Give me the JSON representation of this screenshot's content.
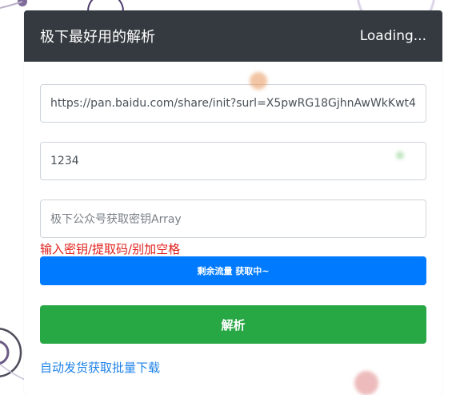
{
  "header": {
    "title": "极下最好用的解析",
    "status": "Loading..."
  },
  "form": {
    "url_value": "https://pan.baidu.com/share/init?surl=X5pwRG18GjhnAwWkKwt4",
    "code_value": "1234",
    "key_placeholder": "极下公众号获取密钥Array",
    "hint": "输入密钥/提取码/别加空格",
    "traffic_button": "剩余流量 获取中~",
    "parse_button": "解析",
    "link_text": "自动发货获取批量下载"
  },
  "colors": {
    "header_bg": "#343a40",
    "blue_button": "#007bff",
    "green_button": "#28a745",
    "hint": "#e0201b",
    "link": "#1f83e8"
  }
}
